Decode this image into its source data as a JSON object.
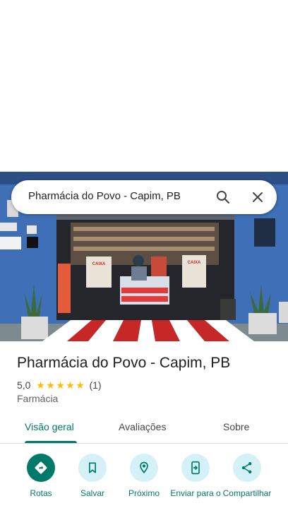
{
  "search": {
    "query": "Pharmácia do Povo - Capim, PB"
  },
  "place": {
    "name": "Pharmácia do Povo - Capim, PB",
    "rating": "5,0",
    "stars": 5,
    "review_count": "(1)",
    "category": "Farmácia"
  },
  "photo_signs": {
    "left": "CAIXA",
    "right": "CAIXA"
  },
  "tabs": [
    {
      "label": "Visão geral",
      "selected": true
    },
    {
      "label": "Avaliações",
      "selected": false
    },
    {
      "label": "Sobre",
      "selected": false
    }
  ],
  "actions": [
    {
      "label": "Rotas",
      "icon": "directions-icon"
    },
    {
      "label": "Salvar",
      "icon": "bookmark-icon"
    },
    {
      "label": "Próximo",
      "icon": "nearby-icon"
    },
    {
      "label": "Enviar para o",
      "icon": "send-to-phone-icon"
    },
    {
      "label": "Compartilhar",
      "icon": "share-icon"
    }
  ],
  "colors": {
    "accent": "#00796b",
    "action_bg": "#d4f1f7",
    "star": "#fbbc04",
    "wall_blue": "#3d6fb8"
  }
}
